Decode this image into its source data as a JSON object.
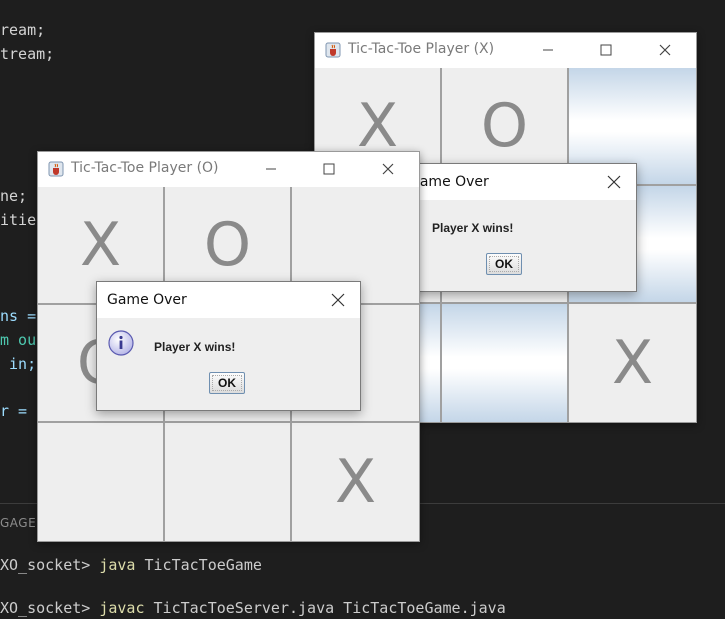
{
  "editor": {
    "lines": [
      "ream;",
      "tream;",
      "ne;",
      "itie",
      "ns =",
      "m ou",
      " in;",
      "r ="
    ],
    "panel_label": "GAGE"
  },
  "terminal": {
    "line1_prefix": "XO_socket> ",
    "line1_cmd": "java",
    "line1_args": " TicTacToeGame",
    "line2_prefix": "XO_socket> ",
    "line2_cmd": "javac",
    "line2_args": " TicTacToeServer.java TicTacToeGame.java"
  },
  "window_x": {
    "title": "Tic-Tac-Toe Player (X)",
    "board": [
      "X",
      "O",
      "",
      "",
      "",
      "",
      "",
      "",
      "X"
    ],
    "highlighted_cells": [
      2,
      5,
      6,
      7
    ],
    "dialog": {
      "title": "Game Over",
      "message": "Player X wins!",
      "ok_label": "OK"
    }
  },
  "window_o": {
    "title": "Tic-Tac-Toe Player (O)",
    "board": [
      "X",
      "O",
      "",
      "O",
      "",
      "",
      "",
      "",
      "X"
    ],
    "dialog": {
      "title": "Game Over",
      "message": "Player X wins!",
      "ok_label": "OK"
    }
  },
  "colors": {
    "editor_bg": "#1e1e1e",
    "command_yellow": "#dcdcaa",
    "variable_blue": "#9cdcfe",
    "cell_bg": "#eeeeee",
    "mark_gray": "#8a8a8a",
    "highlight_blue": "#c4d6e8"
  },
  "icons": {
    "window_icon": "java-cup-icon",
    "minimize": "minimize-icon",
    "maximize": "maximize-icon",
    "close": "close-icon",
    "info": "info-icon"
  }
}
